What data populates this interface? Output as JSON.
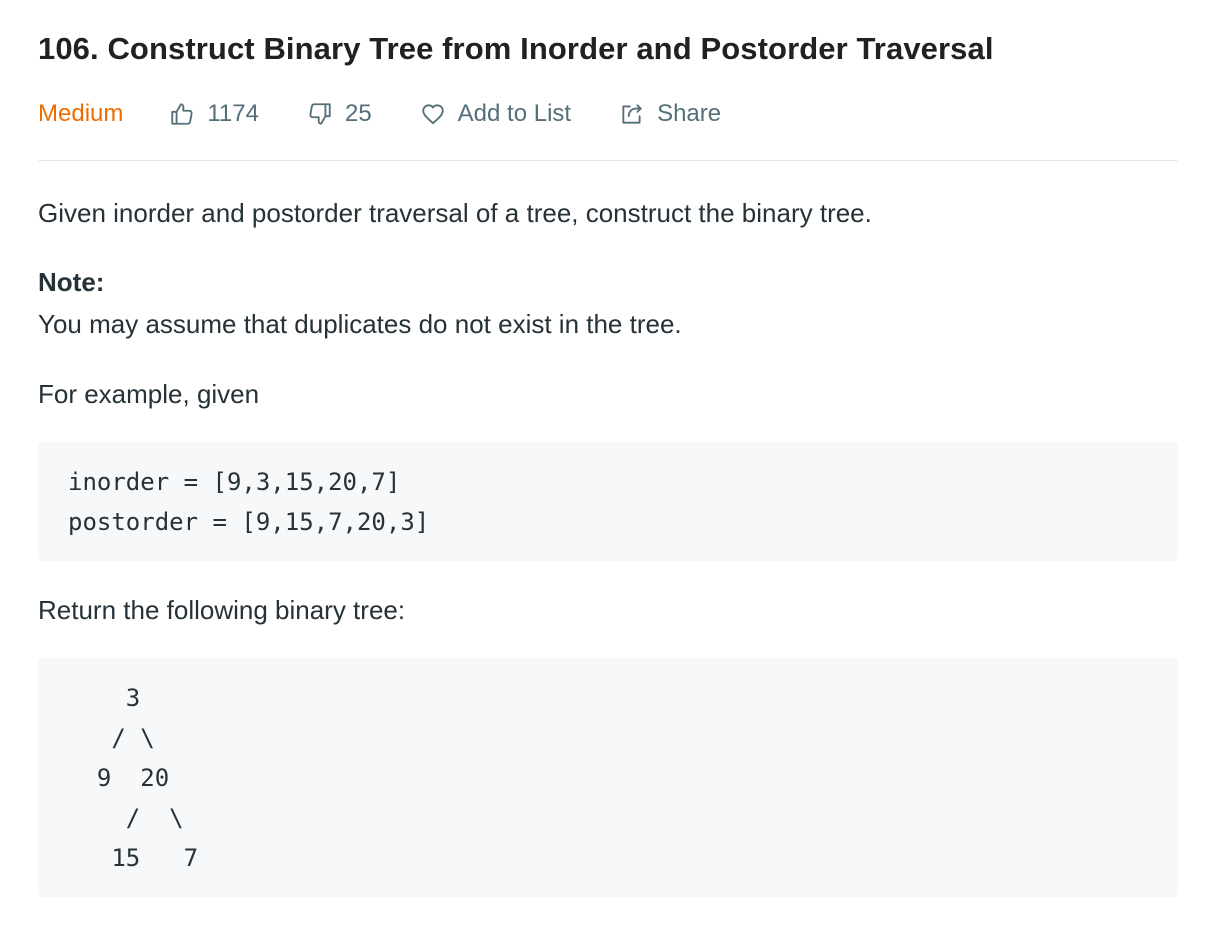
{
  "problem": {
    "title": "106. Construct Binary Tree from Inorder and Postorder Traversal",
    "difficulty": "Medium",
    "likes": "1174",
    "dislikes": "25",
    "add_to_list": "Add to List",
    "share": "Share"
  },
  "description": {
    "intro": "Given inorder and postorder traversal of a tree, construct the binary tree.",
    "note_label": "Note:",
    "note_text": "You may assume that duplicates do not exist in the tree.",
    "example_label": "For example, given",
    "example_code": [
      "inorder = [9,3,15,20,7]",
      "postorder = [9,15,7,20,3]"
    ],
    "return_label": "Return the following binary tree:",
    "tree_code": [
      "    3",
      "   / \\",
      "  9  20",
      "    /  \\",
      "   15   7"
    ]
  },
  "icons": {
    "like": "thumbs-up-icon",
    "dislike": "thumbs-down-icon",
    "add_to_list": "heart-icon",
    "share": "share-icon"
  },
  "colors": {
    "title": "#212121",
    "text": "#263238",
    "meta": "#546e7a",
    "medium": "#ef6c00",
    "code_bg": "#f7f8fa",
    "divider": "#e5e7eb"
  }
}
